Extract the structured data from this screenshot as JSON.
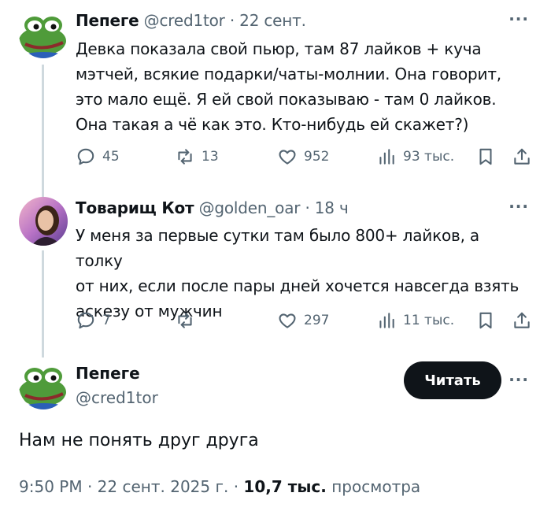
{
  "tweets": [
    {
      "name": "Пепеге",
      "handle": "@cred1tor",
      "sep": " · ",
      "time": "22 сент.",
      "more": "···",
      "text": "Девка показала свой пьюр, там 87 лайков + куча\nмэтчей, всякие подарки/чаты-молнии. Она говорит,\nэто мало ещё. Я ей свой показываю - там 0 лайков.\nОна такая а чё как это. Кто-нибудь ей скажет?)",
      "replies": "45",
      "reposts": "13",
      "likes": "952",
      "views": "93 тыс."
    },
    {
      "name": "Товарищ Кот",
      "handle": "@golden_oar",
      "sep": " · ",
      "time": "18 ч",
      "more": "···",
      "text": "У меня за первые сутки там было 800+ лайков, а толку\nот них, если после пары дней хочется навсегда взять\nаскезу от мужчин",
      "replies": "7",
      "reposts": "",
      "likes": "297",
      "views": "11 тыс."
    }
  ],
  "main_tweet": {
    "name": "Пепеге",
    "handle": "@cred1tor",
    "follow_label": "Читать",
    "more": "···",
    "text": "Нам не понять друг друга",
    "time": "9:50 PM",
    "date": "22 сент. 2025 г.",
    "views_count": "10,7 тыс.",
    "views_label": "просмотра"
  },
  "icons": {
    "reply": "reply-icon",
    "repost": "repost-icon",
    "like": "heart-icon",
    "views": "views-icon",
    "bookmark": "bookmark-icon",
    "share": "share-icon"
  },
  "colors": {
    "text": "#0f1419",
    "secondary": "#536471",
    "thread_line": "#cfd9de",
    "button_bg": "#0f1419",
    "frog_green": "#4f9b3a"
  }
}
